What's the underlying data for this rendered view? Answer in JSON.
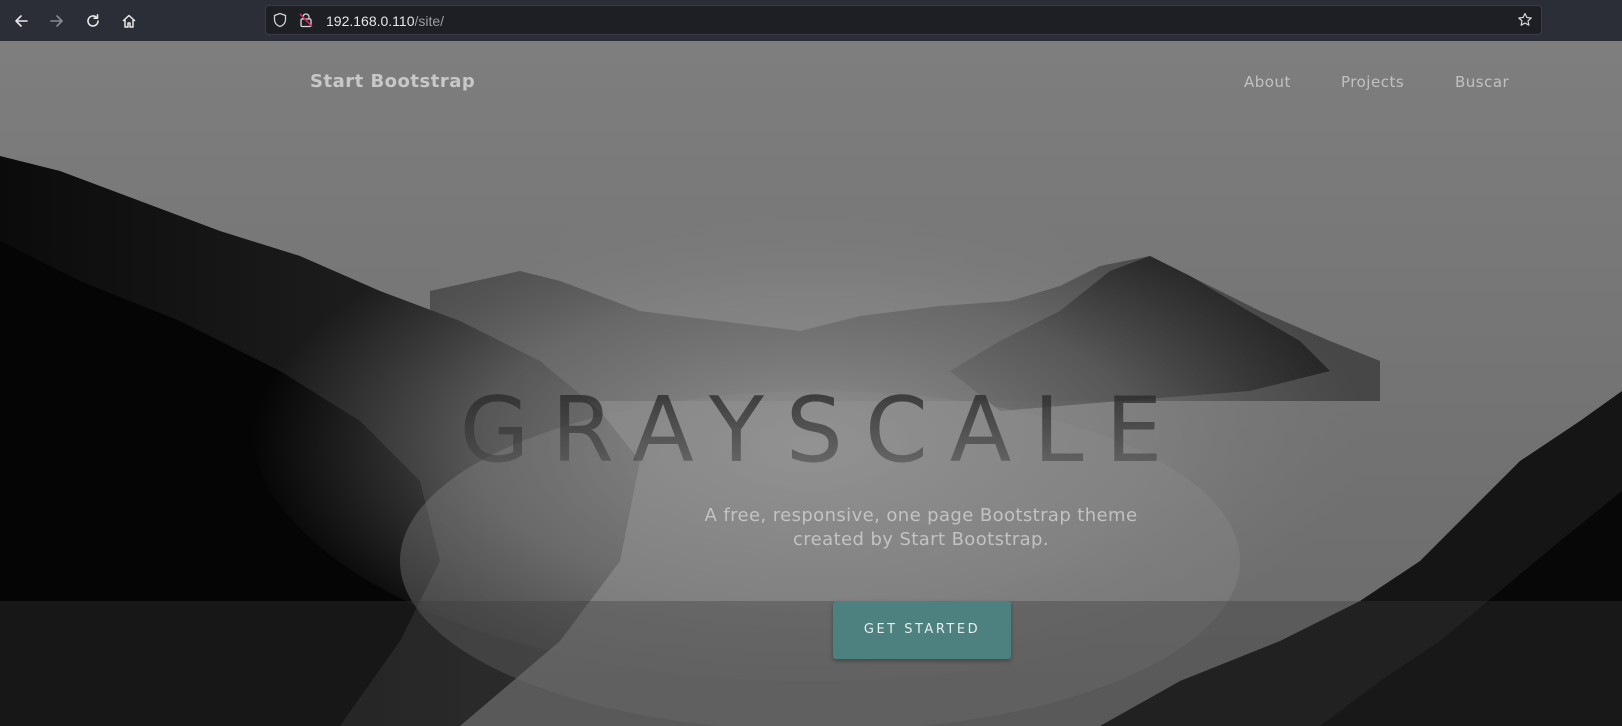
{
  "browser": {
    "url_host": "192.168.0.110",
    "url_path": "/site/",
    "icons": [
      "back-icon",
      "forward-icon",
      "reload-icon",
      "home-icon",
      "shield-icon",
      "lock-icon",
      "bookmark-star-icon"
    ]
  },
  "site": {
    "brand": "Start Bootstrap",
    "nav": [
      {
        "label": "About"
      },
      {
        "label": "Projects"
      },
      {
        "label": "Buscar"
      }
    ],
    "headline": "GRAYSCALE",
    "subtitle_line1": "A free, responsive, one page Bootstrap theme",
    "subtitle_line2": "created by Start Bootstrap.",
    "cta_label": "GET STARTED"
  },
  "colors": {
    "toolbar": "#2b2e36",
    "cta": "#4d8180",
    "lock_alert": "#e0245e"
  }
}
